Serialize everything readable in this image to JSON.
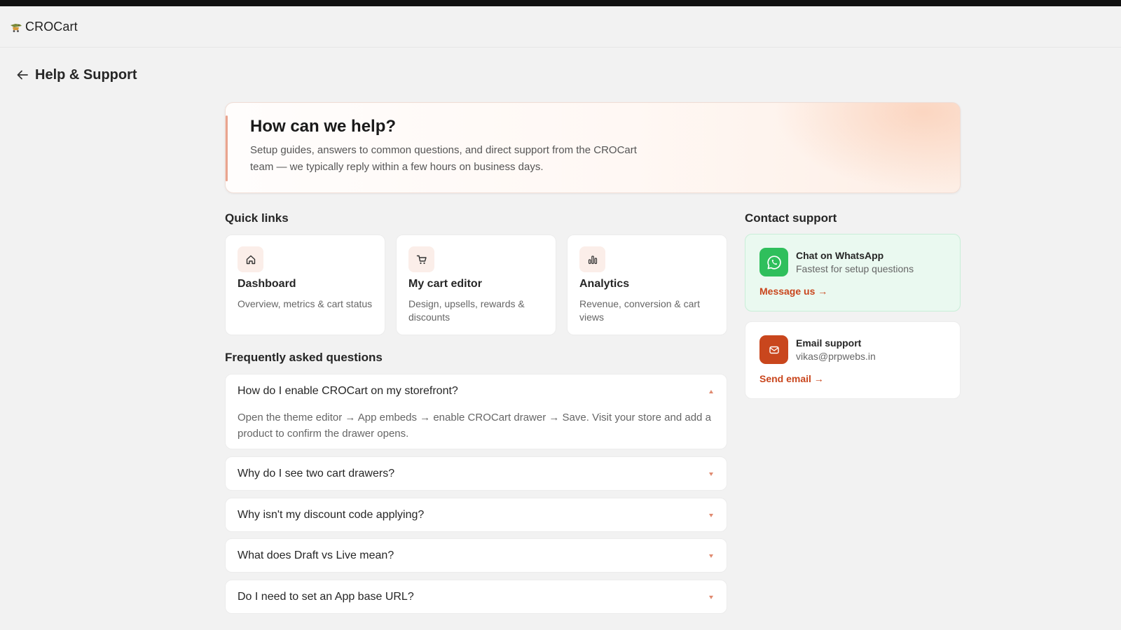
{
  "app": {
    "name": "CROCart",
    "logo_icon": "crocodile-cart-logo-icon"
  },
  "page": {
    "title": "Help & Support",
    "back_icon": "arrow-left-icon"
  },
  "hero": {
    "title": "How can we help?",
    "description": "Setup guides, answers to common questions, and direct support from the CROCart team — we typically reply within a few hours on business days."
  },
  "quick_links": {
    "heading": "Quick links",
    "items": [
      {
        "title": "Dashboard",
        "description": "Overview, metrics & cart status",
        "icon": "home-icon"
      },
      {
        "title": "My cart editor",
        "description": "Design, upsells, rewards & discounts",
        "icon": "cart-icon"
      },
      {
        "title": "Analytics",
        "description": "Revenue, conversion & cart views",
        "icon": "bar-chart-icon"
      }
    ]
  },
  "faq": {
    "heading": "Frequently asked questions",
    "items": [
      {
        "question": "How do I enable CROCart on my storefront?",
        "answer": "Open the theme editor → App embeds → enable CROCart drawer → Save. Visit your store and add a product to confirm the drawer opens.",
        "expanded": true
      },
      {
        "question": "Why do I see two cart drawers?",
        "expanded": false
      },
      {
        "question": "Why isn't my discount code applying?",
        "expanded": false
      },
      {
        "question": "What does Draft vs Live mean?",
        "expanded": false
      },
      {
        "question": "Do I need to set an App base URL?",
        "expanded": false
      }
    ]
  },
  "contact": {
    "heading": "Contact support",
    "whatsapp": {
      "title": "Chat on WhatsApp",
      "subtitle": "Fastest for setup questions",
      "link": "Message us →",
      "icon": "whatsapp-icon",
      "color": "#2fbf5c"
    },
    "email": {
      "title": "Email support",
      "subtitle": "vikas@prpwebs.in",
      "link": "Send email →",
      "icon": "mail-icon",
      "color": "#c9461d"
    }
  },
  "colors": {
    "accent": "#c9461d",
    "background": "#f2f2f2",
    "whatsapp_bg": "#eaf9f0"
  }
}
